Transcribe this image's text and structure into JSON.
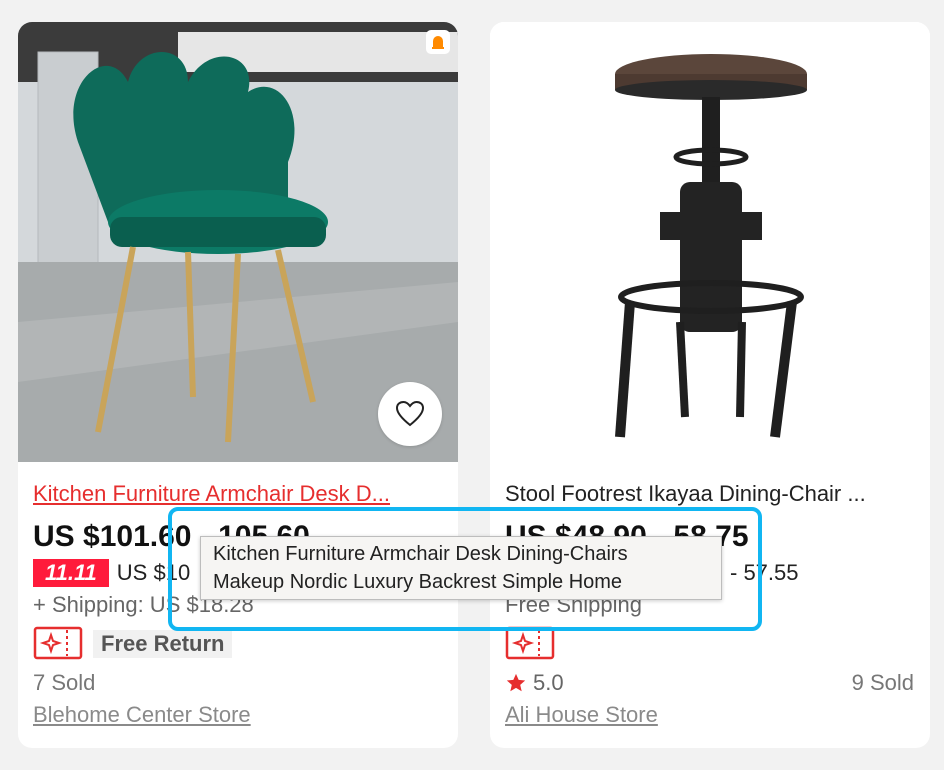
{
  "products": [
    {
      "title": "Kitchen Furniture Armchair Desk D...",
      "price": "US $101.60 - 105.60",
      "sale_tag": "11.11",
      "sale_price": "US $10",
      "shipping": "+ Shipping: US $18.28",
      "free_return": "Free Return",
      "sold": "7 Sold",
      "store": "Blehome Center Store"
    },
    {
      "title": "Stool Footrest Ikayaa Dining-Chair ...",
      "price": "US $48.90 - 58.75",
      "sale_price": "- 57.55",
      "shipping": "Free Shipping",
      "rating": "5.0",
      "sold": "9 Sold",
      "store": "Ali House Store"
    }
  ],
  "tooltip": {
    "line1": "Kitchen Furniture Armchair Desk Dining-Chairs",
    "line2": "Makeup Nordic Luxury Backrest Simple Home"
  },
  "colors": {
    "sale_red": "#ff1b3b",
    "title_red": "#e62e2e",
    "highlight_blue": "#11b6f2",
    "star": "#e62e2e"
  },
  "icons": [
    "heart-icon",
    "shopping-badge-icon",
    "coupon-icon",
    "star-icon"
  ]
}
